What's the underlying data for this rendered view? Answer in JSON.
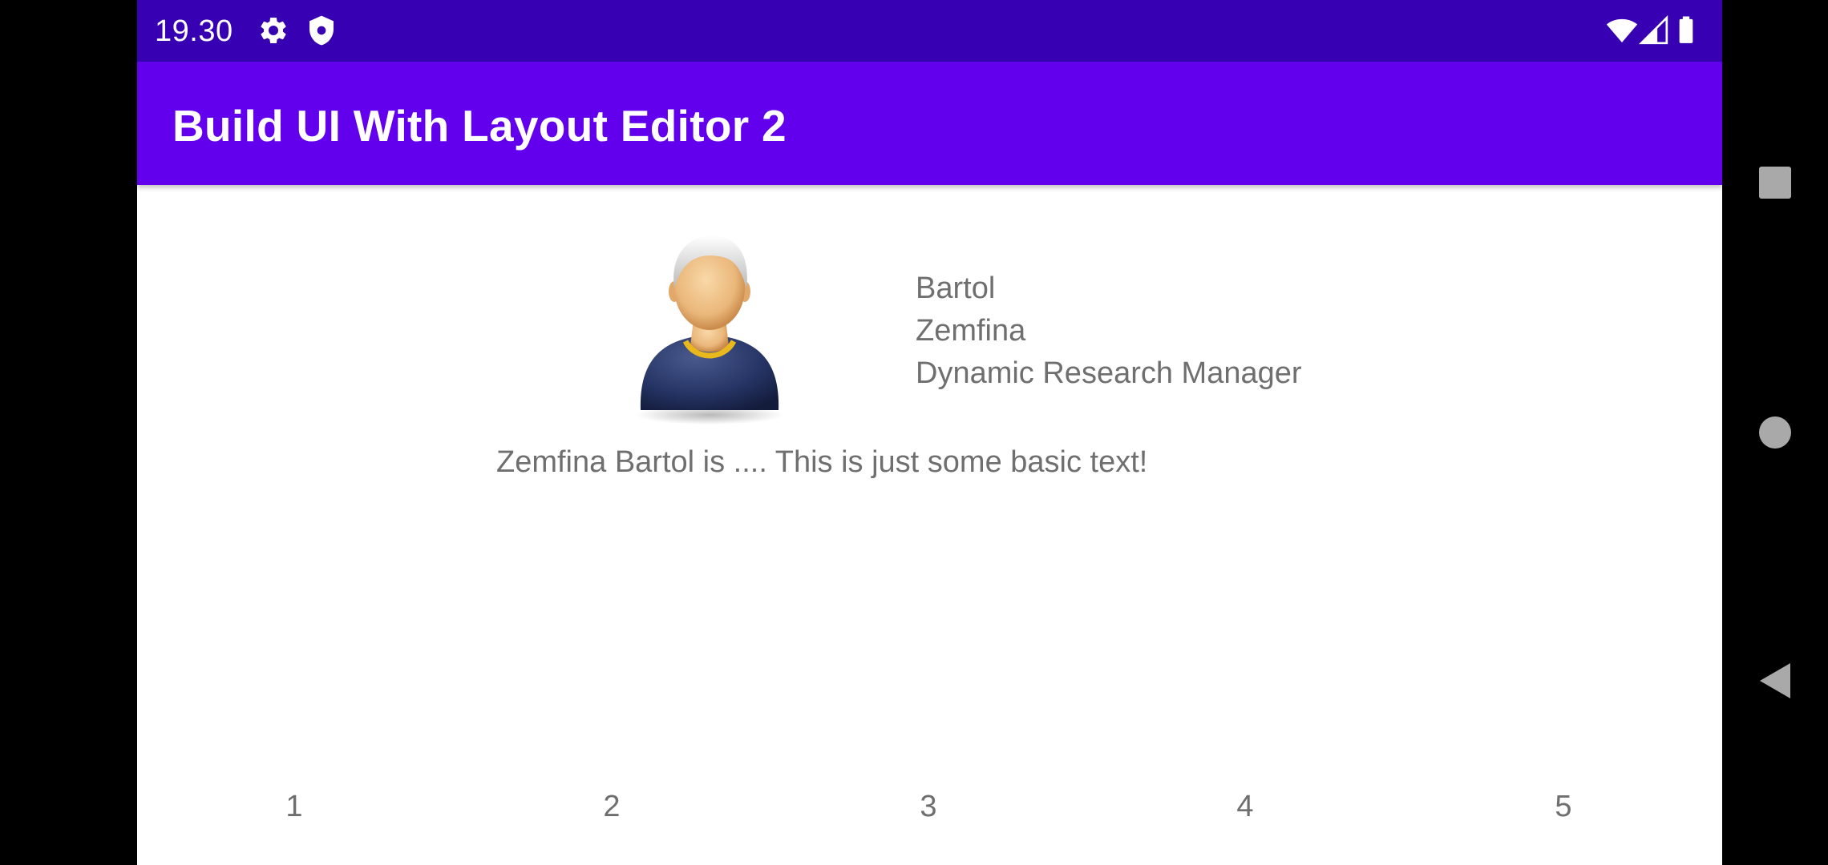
{
  "status_bar": {
    "time": "19.30",
    "left_icons": [
      "gear-icon",
      "shield-icon"
    ],
    "right_icons": [
      "wifi-icon",
      "signal-icon",
      "battery-icon"
    ]
  },
  "app_bar": {
    "title": "Build UI With Layout Editor 2"
  },
  "profile": {
    "avatar_icon": "person-avatar-icon",
    "first_name": "Bartol",
    "last_name": "Zemfina",
    "job_title": "Dynamic Research Manager",
    "description": "Zemfina Bartol is .... This is just some basic text!"
  },
  "numbers": [
    "1",
    "2",
    "3",
    "4",
    "5"
  ],
  "nav_bar": {
    "buttons": [
      "recents-square-icon",
      "home-circle-icon",
      "back-triangle-icon"
    ]
  },
  "colors": {
    "status_bar": "#3700B3",
    "app_bar": "#6200EE",
    "text_gray": "#6f6f6f",
    "background": "#ffffff"
  }
}
